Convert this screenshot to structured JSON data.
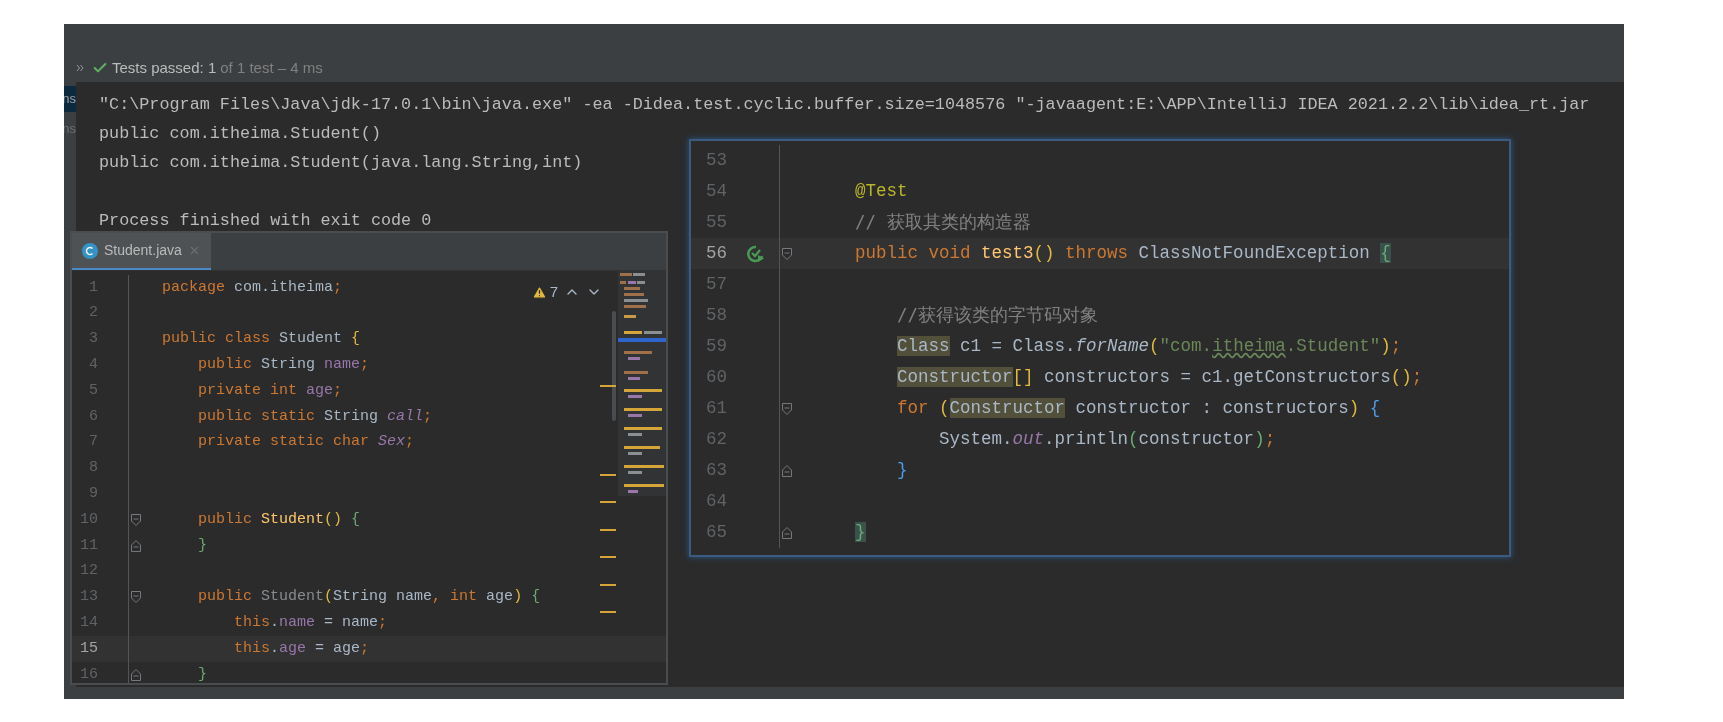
{
  "header": {
    "status_label": "Tests passed: 1",
    "status_detail": "of 1 test – 4 ms"
  },
  "side_tabs": [
    {
      "label": "ns",
      "selected": true
    },
    {
      "label": "ns",
      "selected": false
    }
  ],
  "console": {
    "lines": [
      "\"C:\\Program Files\\Java\\jdk-17.0.1\\bin\\java.exe\" -ea -Didea.test.cyclic.buffer.size=1048576 \"-javaagent:E:\\APP\\IntelliJ IDEA 2021.2.2\\lib\\idea_rt.jar",
      "public com.itheima.Student()",
      "public com.itheima.Student(java.lang.String,int)"
    ],
    "exit_message": "Process finished with exit code 0"
  },
  "left_editor": {
    "tab": {
      "label": "Student.java"
    },
    "warnings": "7",
    "lines": [
      {
        "number": "1",
        "current": false,
        "fold_open": false,
        "fold_close": false,
        "tokens": [
          {
            "kind": "kw",
            "t": "package"
          },
          {
            "kind": "plain",
            "t": " com.itheima"
          },
          {
            "kind": "kw",
            "t": ";"
          }
        ]
      },
      {
        "number": "2",
        "current": false,
        "fold_open": false,
        "fold_close": false
      },
      {
        "number": "3",
        "current": false,
        "fold_open": false,
        "fold_close": false,
        "tokens": [
          {
            "kind": "kw",
            "t": "public class "
          },
          {
            "kind": "plain",
            "t": "Student "
          },
          {
            "kind": "paren_y",
            "t": "{"
          }
        ]
      },
      {
        "number": "4",
        "current": false,
        "fold_open": false,
        "fold_close": false,
        "tokens": [
          {
            "kind": "kw",
            "t": "    public "
          },
          {
            "kind": "plain",
            "t": "String "
          },
          {
            "kind": "field",
            "t": "name"
          },
          {
            "kind": "kw",
            "t": ";"
          }
        ]
      },
      {
        "number": "5",
        "current": false,
        "fold_open": false,
        "fold_close": false,
        "tokens": [
          {
            "kind": "kw",
            "t": "    private int "
          },
          {
            "kind": "field",
            "t": "age"
          },
          {
            "kind": "kw",
            "t": ";"
          }
        ]
      },
      {
        "number": "6",
        "current": false,
        "fold_open": false,
        "fold_close": false,
        "tokens": [
          {
            "kind": "kw",
            "t": "    public static "
          },
          {
            "kind": "plain",
            "t": "String "
          },
          {
            "kind": "sfield",
            "t": "call"
          },
          {
            "kind": "kw",
            "t": ";"
          }
        ]
      },
      {
        "number": "7",
        "current": false,
        "fold_open": false,
        "fold_close": false,
        "tokens": [
          {
            "kind": "kw",
            "t": "    private static char "
          },
          {
            "kind": "sfield",
            "t": "Sex"
          },
          {
            "kind": "kw",
            "t": ";"
          }
        ]
      },
      {
        "number": "8",
        "current": false,
        "fold_open": false,
        "fold_close": false
      },
      {
        "number": "9",
        "current": false,
        "fold_open": false,
        "fold_close": false
      },
      {
        "number": "10",
        "current": false,
        "fold_open": true,
        "fold_close": false,
        "tokens": [
          {
            "kind": "kw",
            "t": "    public "
          },
          {
            "kind": "method",
            "t": "Student"
          },
          {
            "kind": "paren_y",
            "t": "()"
          },
          {
            "kind": "brace_g",
            "t": " {"
          }
        ]
      },
      {
        "number": "11",
        "current": false,
        "fold_open": false,
        "fold_close": true,
        "tokens": [
          {
            "kind": "brace_g",
            "t": "    }"
          }
        ]
      },
      {
        "number": "12",
        "current": false,
        "fold_open": false,
        "fold_close": false
      },
      {
        "number": "13",
        "current": false,
        "fold_open": true,
        "fold_close": false,
        "tokens": [
          {
            "kind": "kw",
            "t": "    public "
          },
          {
            "kind": "unused",
            "t": "Student"
          },
          {
            "kind": "paren_y",
            "t": "("
          },
          {
            "kind": "plain",
            "t": "String name"
          },
          {
            "kind": "kw",
            "t": ", int "
          },
          {
            "kind": "plain",
            "t": "age"
          },
          {
            "kind": "paren_y",
            "t": ")"
          },
          {
            "kind": "brace_g",
            "t": " {"
          }
        ]
      },
      {
        "number": "14",
        "current": false,
        "fold_open": false,
        "fold_close": false,
        "tokens": [
          {
            "kind": "kw",
            "t": "        this"
          },
          {
            "kind": "plain",
            "t": "."
          },
          {
            "kind": "field",
            "t": "name"
          },
          {
            "kind": "plain",
            "t": " = name"
          },
          {
            "kind": "kw",
            "t": ";"
          }
        ]
      },
      {
        "number": "15",
        "current": true,
        "fold_open": false,
        "fold_close": false,
        "tokens": [
          {
            "kind": "kw",
            "t": "        this"
          },
          {
            "kind": "plain",
            "t": "."
          },
          {
            "kind": "field",
            "t": "age"
          },
          {
            "kind": "plain",
            "t": " = age"
          },
          {
            "kind": "kw",
            "t": ";"
          }
        ]
      },
      {
        "number": "16",
        "current": false,
        "fold_open": false,
        "fold_close": true,
        "tokens": [
          {
            "kind": "brace_g",
            "t": "    }"
          }
        ]
      }
    ]
  },
  "right_editor": {
    "lines": [
      {
        "number": "53",
        "current": false,
        "run_icon": false,
        "fold_open": false,
        "fold_close": false
      },
      {
        "number": "54",
        "current": false,
        "run_icon": false,
        "fold_open": false,
        "fold_close": false,
        "tokens": [
          {
            "kind": "annotation",
            "t": "    @Test"
          }
        ]
      },
      {
        "number": "55",
        "current": false,
        "run_icon": false,
        "fold_open": false,
        "fold_close": false,
        "tokens": [
          {
            "kind": "comment",
            "t": "    // 获取其类的构造器"
          }
        ]
      },
      {
        "number": "56",
        "current": true,
        "run_icon": true,
        "fold_open": true,
        "fold_close": false,
        "tokens": [
          {
            "kind": "kw",
            "t": "    public void "
          },
          {
            "kind": "method",
            "t": "test3"
          },
          {
            "kind": "paren_y",
            "t": "()"
          },
          {
            "kind": "kw",
            "t": " throws "
          },
          {
            "kind": "plain",
            "t": "ClassNotFoundException "
          },
          {
            "kind": "brace_g_hl",
            "t": "{"
          }
        ]
      },
      {
        "number": "57",
        "current": false,
        "run_icon": false,
        "fold_open": false,
        "fold_close": false
      },
      {
        "number": "58",
        "current": false,
        "run_icon": false,
        "fold_open": false,
        "fold_close": false,
        "tokens": [
          {
            "kind": "comment",
            "t": "        //获得该类的字节码对象"
          }
        ]
      },
      {
        "number": "59",
        "current": false,
        "run_icon": false,
        "fold_open": false,
        "fold_close": false,
        "tokens": [
          {
            "kind": "hl",
            "t": "        Class"
          },
          {
            "kind": "plain",
            "t": " c1 = Class."
          },
          {
            "kind": "smethod",
            "t": "forName"
          },
          {
            "kind": "paren_y",
            "t": "("
          },
          {
            "kind": "string",
            "t": "\"com."
          },
          {
            "kind": "string_typo",
            "t": "itheima"
          },
          {
            "kind": "string",
            "t": ".Student\""
          },
          {
            "kind": "paren_y",
            "t": ")"
          },
          {
            "kind": "kw",
            "t": ";"
          }
        ]
      },
      {
        "number": "60",
        "current": false,
        "run_icon": false,
        "fold_open": false,
        "fold_close": false,
        "tokens": [
          {
            "kind": "hl",
            "t": "        Constructor"
          },
          {
            "kind": "paren_y",
            "t": "[]"
          },
          {
            "kind": "plain",
            "t": " constructors = c1.getConstructors"
          },
          {
            "kind": "paren_y",
            "t": "()"
          },
          {
            "kind": "kw",
            "t": ";"
          }
        ]
      },
      {
        "number": "61",
        "current": false,
        "run_icon": false,
        "fold_open": true,
        "fold_close": false,
        "tokens": [
          {
            "kind": "kw",
            "t": "        for "
          },
          {
            "kind": "paren_y",
            "t": "("
          },
          {
            "kind": "hl",
            "t": "Constructor"
          },
          {
            "kind": "plain",
            "t": " constructor : constructors"
          },
          {
            "kind": "paren_y",
            "t": ")"
          },
          {
            "kind": "brace_b",
            "t": " {"
          }
        ]
      },
      {
        "number": "62",
        "current": false,
        "run_icon": false,
        "fold_open": false,
        "fold_close": false,
        "tokens": [
          {
            "kind": "plain",
            "t": "            System."
          },
          {
            "kind": "sfield",
            "t": "out"
          },
          {
            "kind": "plain",
            "t": ".println"
          },
          {
            "kind": "paren_g",
            "t": "("
          },
          {
            "kind": "plain",
            "t": "constructor"
          },
          {
            "kind": "paren_g",
            "t": ")"
          },
          {
            "kind": "kw",
            "t": ";"
          }
        ]
      },
      {
        "number": "63",
        "current": false,
        "run_icon": false,
        "fold_open": false,
        "fold_close": true,
        "tokens": [
          {
            "kind": "brace_b",
            "t": "        }"
          }
        ]
      },
      {
        "number": "64",
        "current": false,
        "run_icon": false,
        "fold_open": false,
        "fold_close": false
      },
      {
        "number": "65",
        "current": false,
        "run_icon": false,
        "fold_open": false,
        "fold_close": true,
        "tokens": [
          {
            "kind": "brace_g_hl",
            "t": "    }"
          }
        ]
      }
    ]
  }
}
